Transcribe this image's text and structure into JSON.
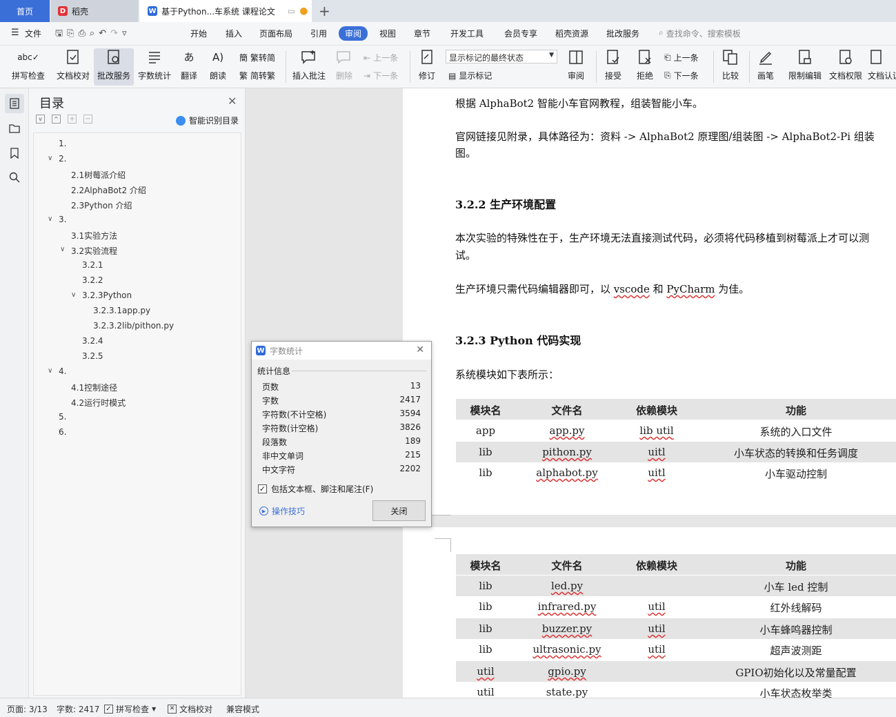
{
  "tabs": {
    "home": "首页",
    "daoke": "稻壳",
    "doc": "基于Python...车系统 课程论文",
    "add": "+"
  },
  "menu": {
    "file": "文件",
    "items": [
      "开始",
      "插入",
      "页面布局",
      "引用",
      "审阅",
      "视图",
      "章节",
      "开发工具",
      "会员专享",
      "稻壳资源",
      "批改服务"
    ],
    "active_index": 4,
    "search_placeholder": "查找命令、搜索模板"
  },
  "toolbar": {
    "spell_check": "拼写检查",
    "doc_proof": "文档校对",
    "correct_service": "批改服务",
    "word_count": "字数统计",
    "translate": "翻译",
    "read_aloud": "朗读",
    "trad_to_simp": "繁转简",
    "simp_to_trad": "简转繁",
    "insert_comment": "插入批注",
    "delete": "删除",
    "prev_comment": "上一条",
    "next_comment": "下一条",
    "revise": "修订",
    "display_state": "显示标记的最终状态",
    "show_marks": "显示标记",
    "review": "审阅",
    "accept": "接受",
    "reject": "拒绝",
    "prev_change": "上一条",
    "next_change": "下一条",
    "compare": "比较",
    "pen": "画笔",
    "restrict_edit": "限制编辑",
    "doc_permission": "文档权限",
    "doc_auth": "文档认证"
  },
  "toc": {
    "title": "目录",
    "smart_label": "智能识别目录",
    "items": [
      {
        "text": "1.",
        "level": 0,
        "chev": ""
      },
      {
        "text": "2.",
        "level": 0,
        "chev": "v"
      },
      {
        "text": "2.1树莓派介绍",
        "level": 1,
        "chev": ""
      },
      {
        "text": "2.2AlphaBot2 介绍",
        "level": 1,
        "chev": ""
      },
      {
        "text": "2.3Python 介绍",
        "level": 1,
        "chev": ""
      },
      {
        "text": "3.",
        "level": 0,
        "chev": "v"
      },
      {
        "text": "3.1实验方法",
        "level": 1,
        "chev": ""
      },
      {
        "text": "3.2实验流程",
        "level": 1,
        "chev": "v"
      },
      {
        "text": "3.2.1",
        "level": 2,
        "chev": ""
      },
      {
        "text": "3.2.2",
        "level": 2,
        "chev": ""
      },
      {
        "text": "3.2.3Python",
        "level": 2,
        "chev": "v"
      },
      {
        "text": "3.2.3.1app.py",
        "level": 3,
        "chev": ""
      },
      {
        "text": "3.2.3.2lib/pithon.py",
        "level": 3,
        "chev": ""
      },
      {
        "text": "3.2.4",
        "level": 2,
        "chev": ""
      },
      {
        "text": "3.2.5",
        "level": 2,
        "chev": ""
      },
      {
        "text": "4.",
        "level": 0,
        "chev": "v"
      },
      {
        "text": "4.1控制途径",
        "level": 1,
        "chev": ""
      },
      {
        "text": "4.2运行时模式",
        "level": 1,
        "chev": ""
      },
      {
        "text": "5.",
        "level": 0,
        "chev": ""
      },
      {
        "text": "6.",
        "level": 0,
        "chev": ""
      }
    ]
  },
  "document": {
    "p1": "根据 AlphaBot2 智能小车官网教程，组装智能小车。",
    "p2a": "官网链接见附录，具体路径为：资料 -> AlphaBot2 原理图/组装图 -> AlphaBot2-Pi 组装",
    "p2b": "图。",
    "h322": "3.2.2 生产环境配置",
    "p3a": "本次实验的特殊性在于，生产环境无法直接测试代码，必须将代码移植到树莓派上才可以测",
    "p3b": "试。",
    "p4a": "生产环境只需代码编辑器即可，以 ",
    "p4_vscode": "vscode",
    "p4b": " 和 ",
    "p4_pycharm": "PyCharm",
    "p4c": " 为佳。",
    "h323": "3.2.3 Python 代码实现",
    "p5": "系统模块如下表所示：",
    "table_headers": [
      "模块名",
      "文件名",
      "依赖模块",
      "功能"
    ],
    "table1": [
      [
        "app",
        "app.py",
        "lib util",
        "系统的入口文件"
      ],
      [
        "lib",
        "pithon.py",
        "uitl",
        "小车状态的转换和任务调度"
      ],
      [
        "lib",
        "alphabot.py",
        "uitl",
        "小车驱动控制"
      ]
    ],
    "table2": [
      [
        "lib",
        "led.py",
        "",
        "小车 led 控制"
      ],
      [
        "lib",
        "infrared.py",
        "util",
        "红外线解码"
      ],
      [
        "lib",
        "buzzer.py",
        "util",
        "小车蜂鸣器控制"
      ],
      [
        "lib",
        "ultrasonic.py",
        "util",
        "超声波测距"
      ],
      [
        "util",
        "gpio.py",
        "",
        "GPIO初始化以及常量配置"
      ],
      [
        "util",
        "state.py",
        "",
        "小车状态枚举类"
      ]
    ]
  },
  "dialog": {
    "title": "字数统计",
    "section": "统计信息",
    "stats": [
      {
        "label": "页数",
        "value": "13"
      },
      {
        "label": "字数",
        "value": "2417"
      },
      {
        "label": "字符数(不计空格)",
        "value": "3594"
      },
      {
        "label": "字符数(计空格)",
        "value": "3826"
      },
      {
        "label": "段落数",
        "value": "189"
      },
      {
        "label": "非中文单词",
        "value": "215"
      },
      {
        "label": "中文字符",
        "value": "2202"
      }
    ],
    "include_label": "包括文本框、脚注和尾注(F)",
    "tips": "操作技巧",
    "close": "关闭"
  },
  "status": {
    "page": "页面: 3/13",
    "words": "字数: 2417",
    "spell": "拼写检查",
    "proof": "文档校对",
    "compat": "兼容模式"
  },
  "colors": {
    "accent": "#3b6fd8",
    "tab_home": "#3b6fd8",
    "daoke_logo": "#e0343a",
    "doc_logo": "#2f6ad8"
  }
}
